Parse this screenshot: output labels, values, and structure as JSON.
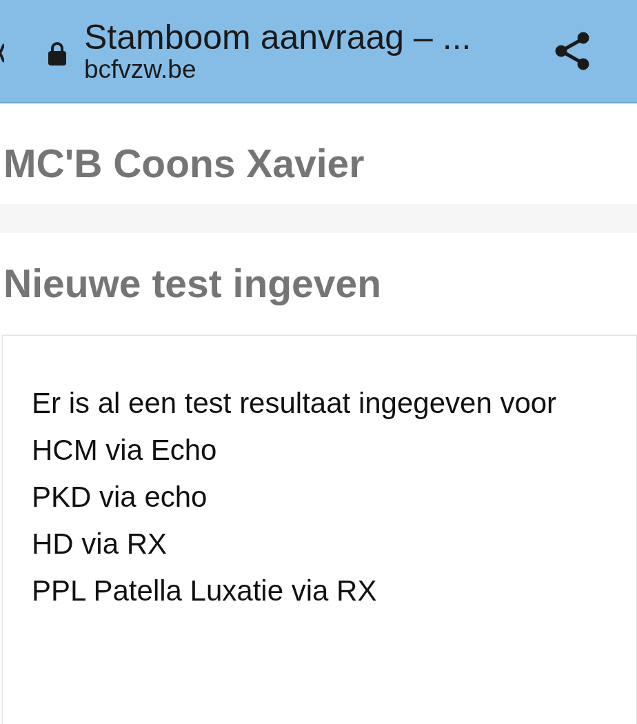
{
  "browser_bar": {
    "title": "Stamboom aanvraag – ...",
    "url": "bcfvzw.be"
  },
  "page": {
    "name": "MC'B Coons Xavier",
    "section_title": "Nieuwe test ingeven",
    "message": {
      "intro": "Er is al een test resultaat ingegeven voor",
      "tests": [
        "HCM via Echo",
        "PKD via echo",
        "HD via RX",
        "PPL Patella Luxatie via RX"
      ]
    }
  }
}
